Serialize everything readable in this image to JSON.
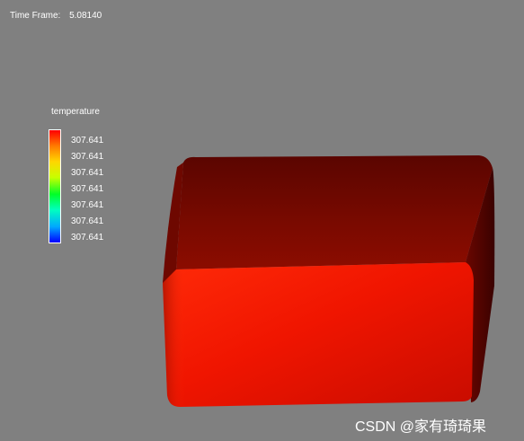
{
  "viewport": {
    "background_color": "#808080"
  },
  "time_frame": {
    "label": "Time Frame:",
    "value": "5.08140"
  },
  "legend": {
    "title": "temperature",
    "colormap": "rainbow",
    "ticks": [
      "307.641",
      "307.641",
      "307.641",
      "307.641",
      "307.641",
      "307.641",
      "307.641"
    ]
  },
  "model": {
    "shape": "box",
    "color": "#ff1a00"
  },
  "watermark": {
    "text": "CSDN @家有琦琦果"
  }
}
